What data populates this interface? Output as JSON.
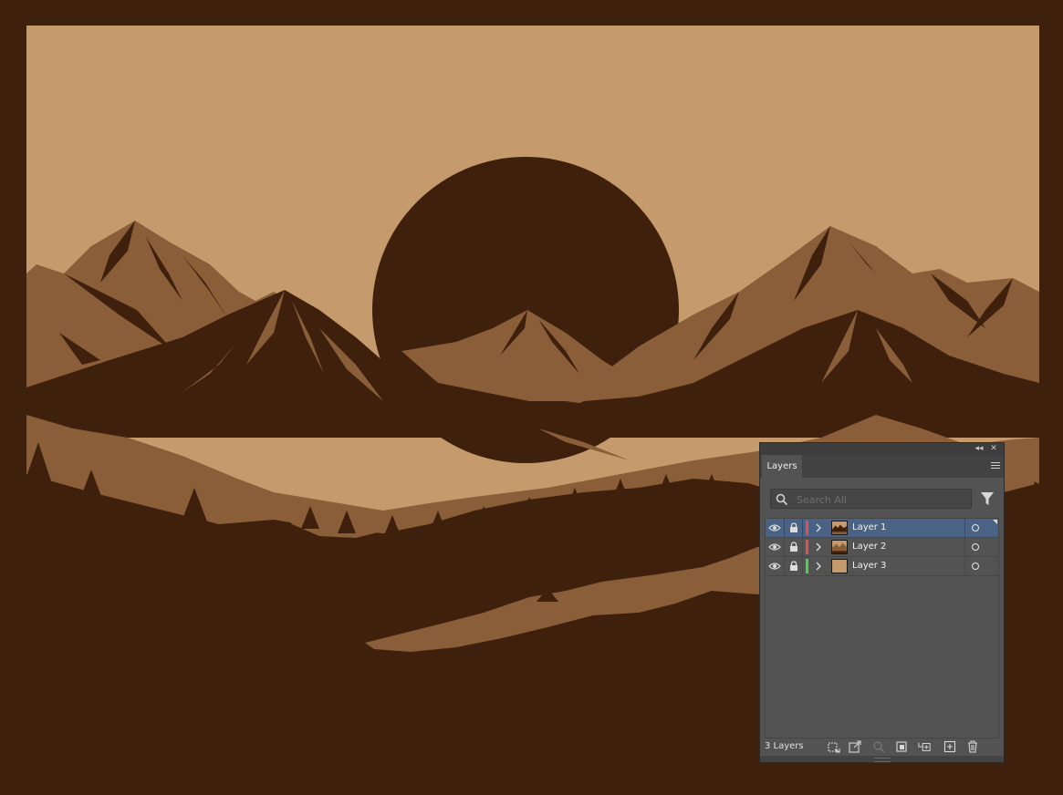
{
  "colors": {
    "outer": "#3e200d",
    "sky": "#c59b6d",
    "mid": "#8a5e38",
    "dark": "#3e200d",
    "panel": "#535353",
    "selected": "#4a6385",
    "layer1_color": "#e05050",
    "layer2_color": "#e05050",
    "layer3_color": "#4fd14f"
  },
  "panel": {
    "tab_label": "Layers",
    "search_placeholder": "Search All",
    "layer_count": "3 Layers",
    "layers": [
      {
        "name": "Layer 1",
        "selected": true,
        "color": "#e05050"
      },
      {
        "name": "Layer 2",
        "selected": false,
        "color": "#e05050"
      },
      {
        "name": "Layer 3",
        "selected": false,
        "color": "#4fd14f"
      }
    ]
  },
  "icons": {
    "collapse": "double-chevron-left-icon",
    "close": "close-icon",
    "menu": "hamburger-menu-icon",
    "search": "search-icon",
    "filter": "filter-icon",
    "visibility": "eye-icon",
    "lock": "lock-icon",
    "expand": "chevron-right-icon",
    "target": "target-circle-icon",
    "footer": [
      "collect-for-export-icon",
      "export-icon",
      "locate-object-icon",
      "make-clipping-mask-icon",
      "create-sublayer-icon",
      "create-new-layer-icon",
      "delete-layer-icon"
    ]
  }
}
